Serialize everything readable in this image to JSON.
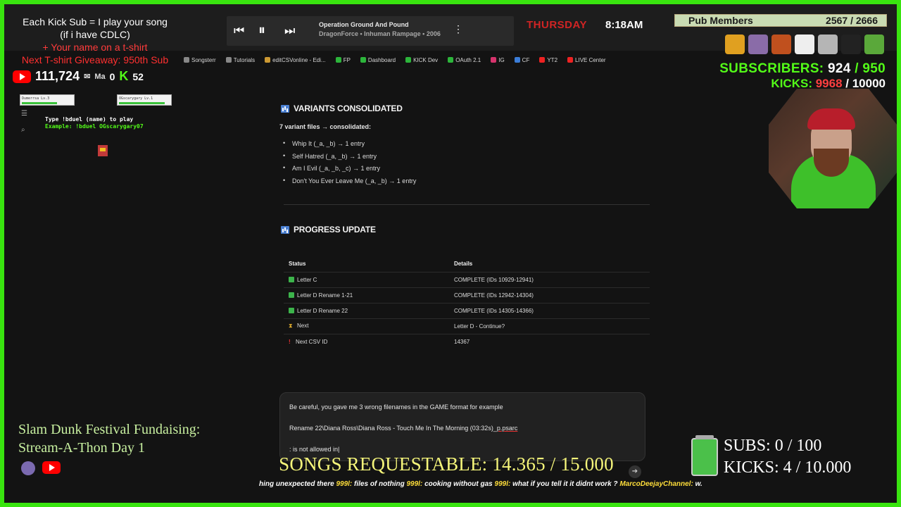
{
  "promo": {
    "line1": "Each Kick Sub = I play your song",
    "line2": "(if i have CDLC)",
    "line3": "+ Your name on a t-shirt",
    "line4": "Next T-shirt Giveaway: 950th Sub"
  },
  "counts": {
    "youtube": "111,724",
    "mail_label": "Ma",
    "other": "0",
    "kick": "52"
  },
  "player": {
    "song": "Operation Ground And Pound",
    "artist": "DragonForce • Inhuman Rampage • 2006"
  },
  "bookmarks": [
    "Songsterr",
    "Tutorials",
    "editCSVonline - Edi...",
    "FP",
    "Dashboard",
    "KICK Dev",
    "OAuth 2.1",
    "IG",
    "CF",
    "YT2",
    "LIVE Center"
  ],
  "duel": {
    "player1": "Dumerrsa",
    "player1_lv": "Lv.3",
    "player2": "OGscarygary",
    "player2_lv": "Lv.1",
    "hint1": "Type !bduel (name) to play",
    "hint2": "Example: !bduel OGscarygary07"
  },
  "clock": {
    "day": "THURSDAY",
    "time": "8:18AM"
  },
  "pub": {
    "label": "Pub Members",
    "value": "2567 / 2666"
  },
  "subs_goal": {
    "label": "SUBSCRIBERS:",
    "current": "924",
    "max": "950"
  },
  "kicks_goal": {
    "label": "KICKS:",
    "current": "9968",
    "max": "10000"
  },
  "content": {
    "variants_heading": "VARIANTS CONSOLIDATED",
    "variants_intro": "7 variant files → consolidated:",
    "variants": [
      "Whip It (_a, _b) → 1 entry",
      "Self Hatred (_a, _b) → 1 entry",
      "Am I Evil (_a, _b, _c) → 1 entry",
      "Don't You Ever Leave Me (_a, _b) → 1 entry"
    ],
    "progress_heading": "PROGRESS UPDATE",
    "table_headers": [
      "Status",
      "Details"
    ],
    "rows": [
      {
        "icon": "check",
        "status": "Letter C",
        "details": "COMPLETE (IDs 10929-12941)"
      },
      {
        "icon": "check",
        "status": "Letter D Rename 1-21",
        "details": "COMPLETE (IDs 12942-14304)"
      },
      {
        "icon": "check",
        "status": "Letter D Rename 22",
        "details": "COMPLETE (IDs 14305-14366)"
      },
      {
        "icon": "hourglass",
        "status": "Next",
        "details": "Letter D - Continue?"
      },
      {
        "icon": "exclamation",
        "status": "Next CSV ID",
        "details": "14367"
      }
    ]
  },
  "input": {
    "line1": "Be careful, you gave me 3 wrong filenames in the GAME format for example",
    "line2_prefix": "Rename 22\\Diana Ross\\Diana Ross - Touch Me In The Morning (03:32s)_",
    "line2_underlined": "p.psarc",
    "line3": ": is not allowed in"
  },
  "fundraiser": {
    "line1": "Slam Dunk Festival Fundaising:",
    "line2": "Stream-A-Thon Day 1"
  },
  "songs_requestable": "SONGS REQUESTABLE: 14.365 / 15.000",
  "bottom_goals": {
    "subs": "SUBS:  0 / 100",
    "kicks": "KICKS: 4 / 10.000"
  },
  "ticker": [
    {
      "text": "hing unexpected there ",
      "hl": false
    },
    {
      "text": "999l: ",
      "hl": true
    },
    {
      "text": "files of nothing ",
      "hl": false
    },
    {
      "text": "999l: ",
      "hl": true
    },
    {
      "text": "cooking without gas ",
      "hl": false
    },
    {
      "text": "999l: ",
      "hl": true
    },
    {
      "text": "what if you tell it it didnt work ?  ",
      "hl": false
    },
    {
      "text": "MarcoDeejayChannel: ",
      "hl": true
    },
    {
      "text": "w.",
      "hl": false
    }
  ],
  "colors": {
    "accent_green": "#53fc18",
    "border_green": "#39e40f",
    "kick_red": "#ff4040"
  }
}
